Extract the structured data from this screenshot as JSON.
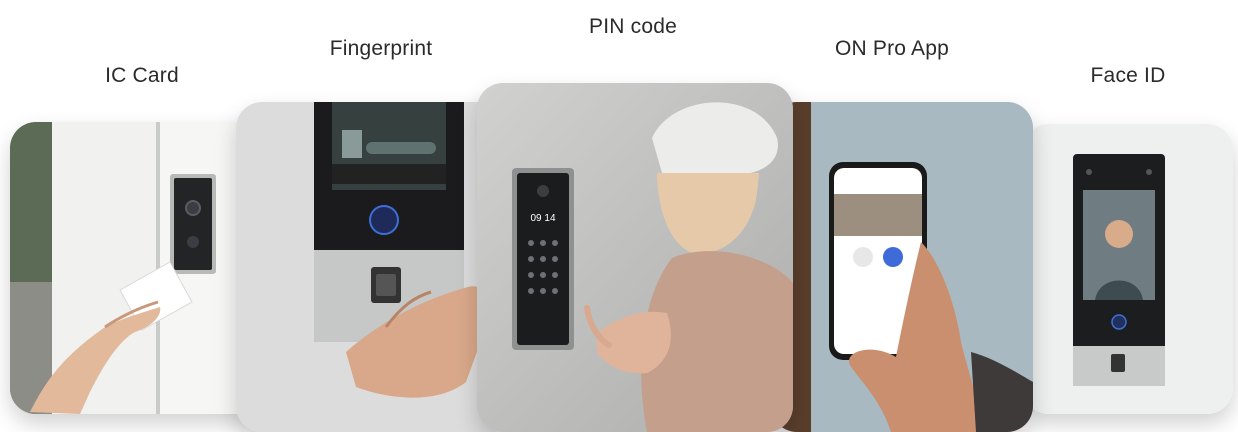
{
  "methods": [
    {
      "label": "IC Card"
    },
    {
      "label": "Fingerprint"
    },
    {
      "label": "PIN code",
      "keypad_time": "09 14"
    },
    {
      "label": "ON Pro App"
    },
    {
      "label": "Face ID"
    }
  ]
}
